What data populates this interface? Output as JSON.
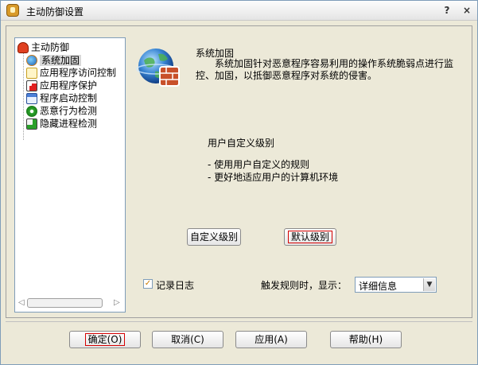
{
  "window": {
    "title": "主动防御设置",
    "help_glyph": "?",
    "close_glyph": "×"
  },
  "tree": {
    "root": {
      "label": "主动防御",
      "icon": "hand-shield-icon"
    },
    "items": [
      {
        "label": "系统加固",
        "icon": "globe-shield-icon",
        "selected": true
      },
      {
        "label": "应用程序访问控制",
        "icon": "app-access-icon"
      },
      {
        "label": "应用程序保护",
        "icon": "no-entry-icon"
      },
      {
        "label": "程序启动控制",
        "icon": "window-start-icon"
      },
      {
        "label": "恶意行为检测",
        "icon": "green-eye-icon"
      },
      {
        "label": "隐藏进程检测",
        "icon": "hidden-process-icon"
      }
    ]
  },
  "content": {
    "section_title": "系统加固",
    "section_desc": "系统加固针对恶意程序容易利用的操作系统脆弱点进行监控、加固，以抵御恶意程序对系统的侵害。",
    "level_title": "用户自定义级别",
    "bullets": [
      "- 使用用户自定义的规则",
      "- 更好地适应用户的计算机环境"
    ],
    "custom_button": "自定义级别",
    "default_button": "默认级别",
    "log_label": "记录日志",
    "log_checked": true,
    "trigger_label": "触发规则时，显示：",
    "display_select": {
      "value": "详细信息"
    }
  },
  "footer": {
    "ok": "确定(O)",
    "cancel": "取消(C)",
    "apply": "应用(A)",
    "help": "帮助(H)"
  },
  "colors": {
    "window_bg": "#ece9d8",
    "border": "#7f9db9",
    "focus_outline": "#d40000",
    "checkmark": "#cc7a00"
  }
}
